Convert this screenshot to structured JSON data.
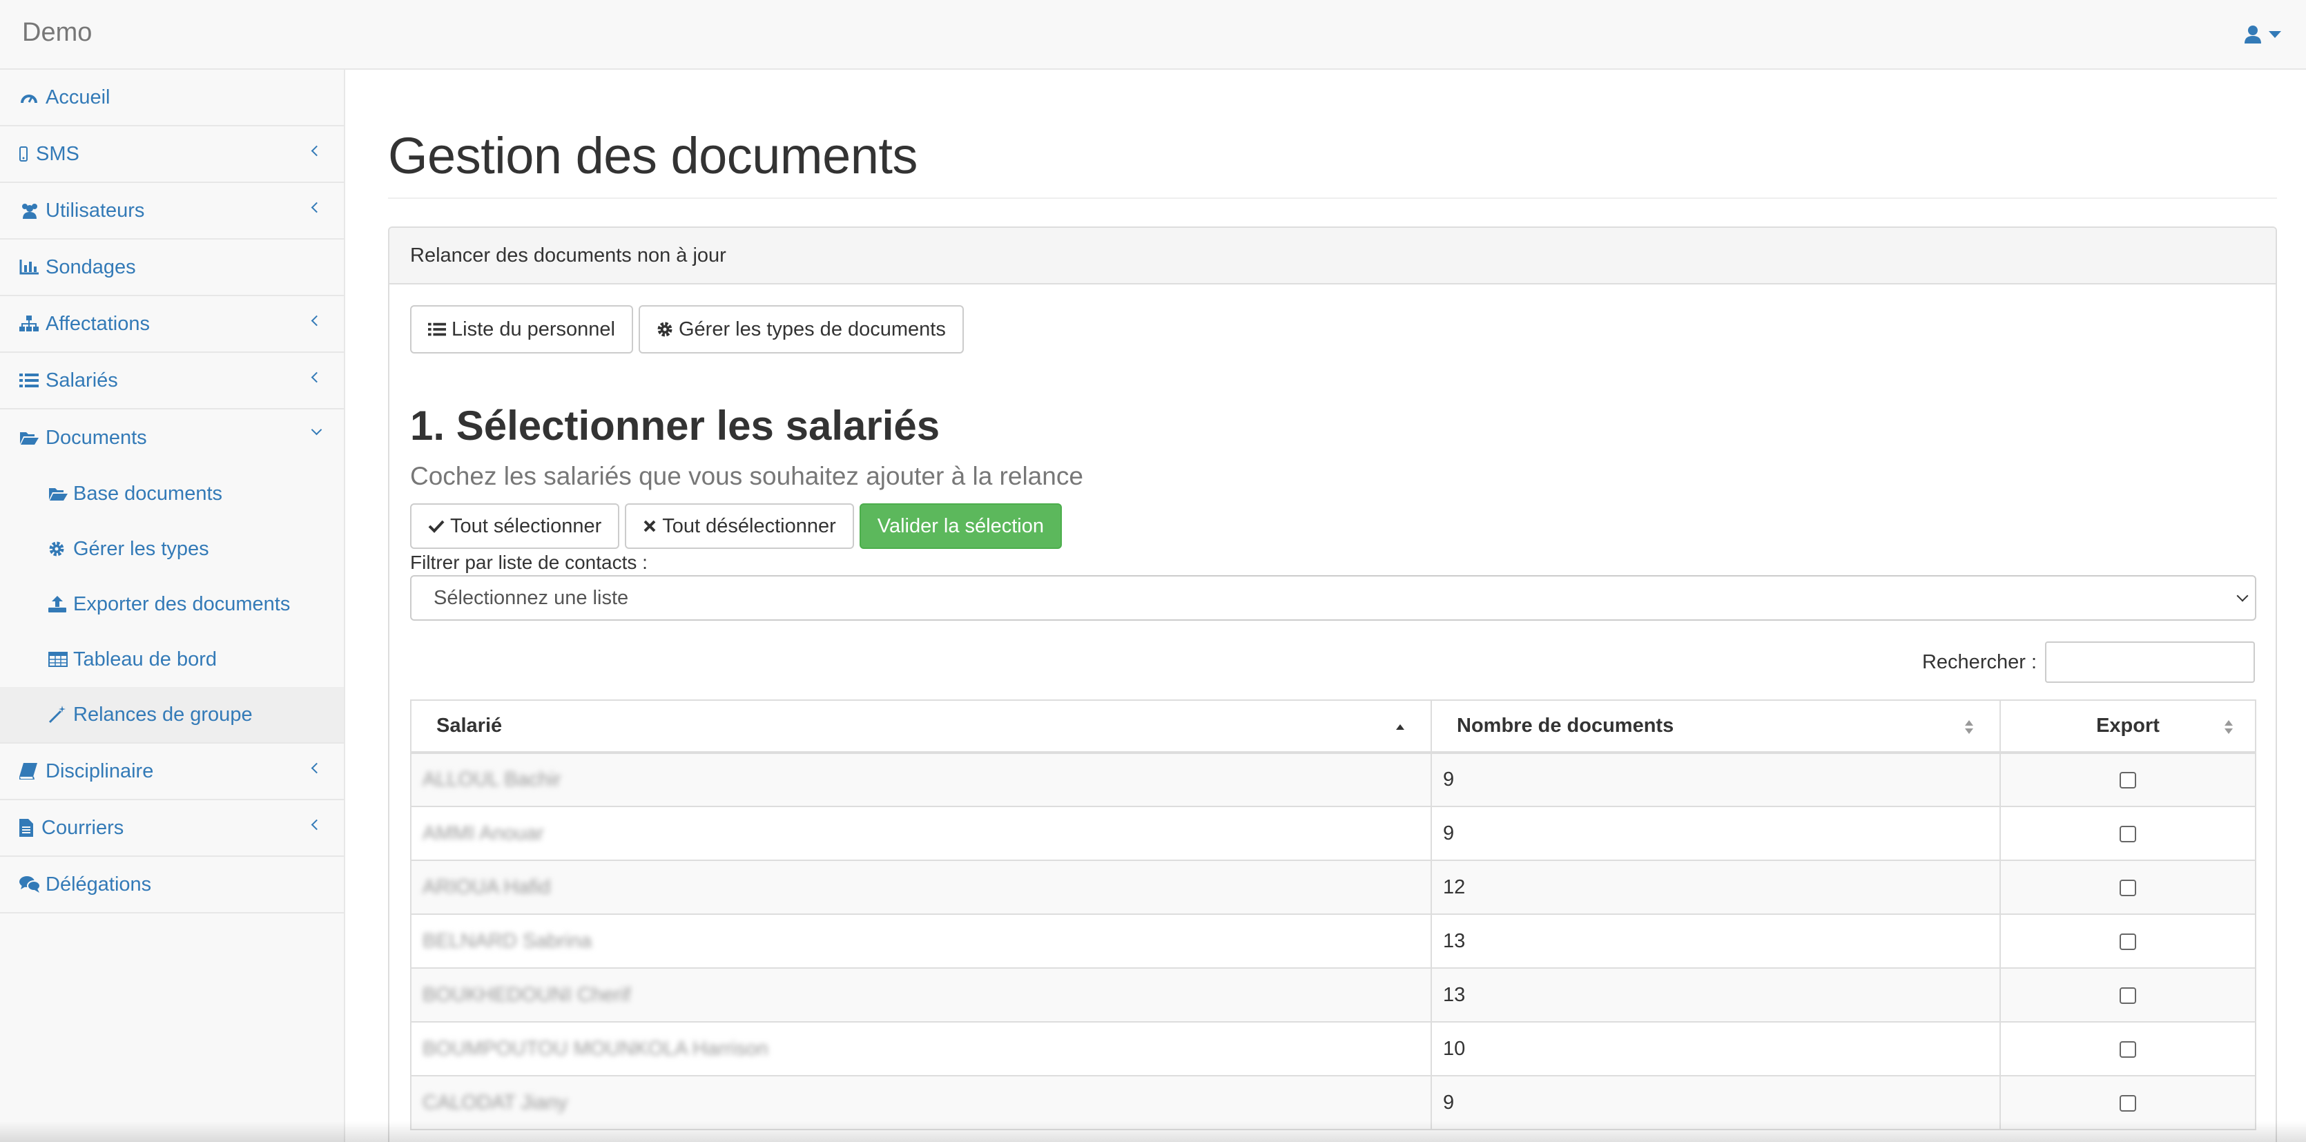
{
  "navbar": {
    "brand": "Demo"
  },
  "sidebar": {
    "items": [
      {
        "label": "Accueil",
        "icon": "dashboard-icon"
      },
      {
        "label": "SMS",
        "icon": "mobile-icon"
      },
      {
        "label": "Utilisateurs",
        "icon": "users-icon"
      },
      {
        "label": "Sondages",
        "icon": "bar-chart-icon"
      },
      {
        "label": "Affectations",
        "icon": "sitemap-icon"
      },
      {
        "label": "Salariés",
        "icon": "list-icon"
      },
      {
        "label": "Documents",
        "icon": "folder-open-icon"
      },
      {
        "label": "Disciplinaire",
        "icon": "book-icon"
      },
      {
        "label": "Courriers",
        "icon": "file-icon"
      },
      {
        "label": "Délégations",
        "icon": "comments-icon"
      }
    ],
    "documents_sub": [
      {
        "label": "Base documents",
        "icon": "folder-open-icon"
      },
      {
        "label": "Gérer les types",
        "icon": "gear-icon"
      },
      {
        "label": "Exporter des documents",
        "icon": "upload-icon"
      },
      {
        "label": "Tableau de bord",
        "icon": "table-icon"
      },
      {
        "label": "Relances de groupe",
        "icon": "magic-wand-icon",
        "active": true
      }
    ]
  },
  "main": {
    "title": "Gestion des documents",
    "panel_heading": "Relancer des documents non à jour",
    "buttons": {
      "personnel": "Liste du personnel",
      "types": "Gérer les types de documents",
      "select_all": "Tout sélectionner",
      "deselect_all": "Tout désélectionner",
      "validate": "Valider la sélection"
    },
    "section_title": "1. Sélectionner les salariés",
    "section_sub": "Cochez les salariés que vous souhaitez ajouter à la relance",
    "filter_label": "Filtrer par liste de contacts :",
    "filter_select": "Sélectionnez une liste",
    "search_label": "Rechercher :",
    "table": {
      "headers": [
        "Salarié",
        "Nombre de documents",
        "Export"
      ],
      "rows": [
        {
          "name": "ALLOUL Bachir",
          "count": "9",
          "export": false
        },
        {
          "name": "AMMI Anouar",
          "count": "9",
          "export": false
        },
        {
          "name": "ARIOUA Hafid",
          "count": "12",
          "export": false
        },
        {
          "name": "BELNARD Sabrina",
          "count": "13",
          "export": false
        },
        {
          "name": "BOUKHEDOUNI Cherif",
          "count": "13",
          "export": false
        },
        {
          "name": "BOUMPOUTOU MOUNKOLA Harrison",
          "count": "10",
          "export": false
        },
        {
          "name": "CALODAT Jiany",
          "count": "9",
          "export": false
        }
      ]
    }
  },
  "colors": {
    "link": "#337ab7",
    "success": "#5cb85c",
    "sidebar_bg": "#f8f8f8",
    "active_item_bg": "#eeeeee"
  }
}
